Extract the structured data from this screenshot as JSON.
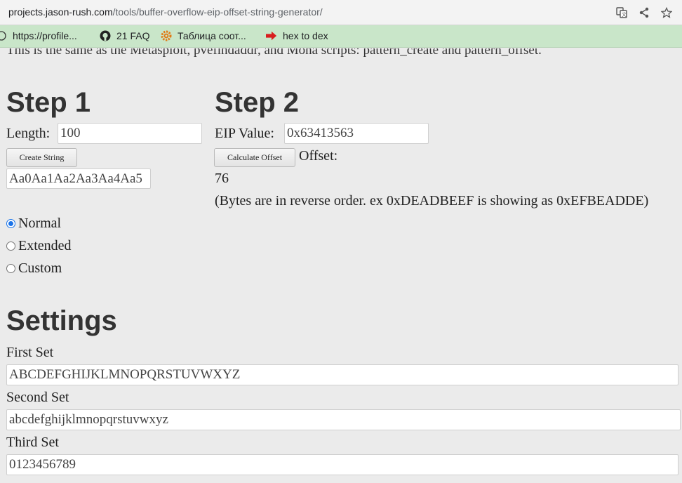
{
  "browser": {
    "url_host": "projects.jason-rush.com",
    "url_path": "/tools/buffer-overflow-eip-offset-string-generator/",
    "icons": [
      "translate-icon",
      "share-icon",
      "star-icon"
    ],
    "bookmarks": [
      {
        "label": "https://profile...",
        "icon": "globe-icon"
      },
      {
        "label": "21 FAQ",
        "icon": "github-icon"
      },
      {
        "label": "Таблица соот...",
        "icon": "gear-icon"
      },
      {
        "label": "hex to dex",
        "icon": "red-arrow-icon"
      }
    ]
  },
  "intro": "This is the same as the Metasploit, pvefindaddr, and Mona scripts: pattern_create and pattern_offset.",
  "step1": {
    "title": "Step 1",
    "length_label": "Length:",
    "length_value": "100",
    "create_button": "Create String",
    "pattern_value": "Aa0Aa1Aa2Aa3Aa4Aa5",
    "modes": [
      {
        "label": "Normal",
        "checked": true
      },
      {
        "label": "Extended",
        "checked": false
      },
      {
        "label": "Custom",
        "checked": false
      }
    ]
  },
  "step2": {
    "title": "Step 2",
    "eip_label": "EIP Value:",
    "eip_value": "0x63413563",
    "calc_button": "Calculate Offset",
    "offset_label": "Offset:",
    "offset_value": "76",
    "note": "(Bytes are in reverse order. ex 0xDEADBEEF is showing as 0xEFBEADDE)"
  },
  "settings": {
    "title": "Settings",
    "first_label": "First Set",
    "first_value": "ABCDEFGHIJKLMNOPQRSTUVWXYZ",
    "second_label": "Second Set",
    "second_value": "abcdefghijklmnopqrstuvwxyz",
    "third_label": "Third Set",
    "third_value": "0123456789"
  },
  "colors": {
    "bookmarks_bar": "#c9e6c9",
    "page_bg": "#ebebeb",
    "radio_accent": "#1a73e8"
  }
}
